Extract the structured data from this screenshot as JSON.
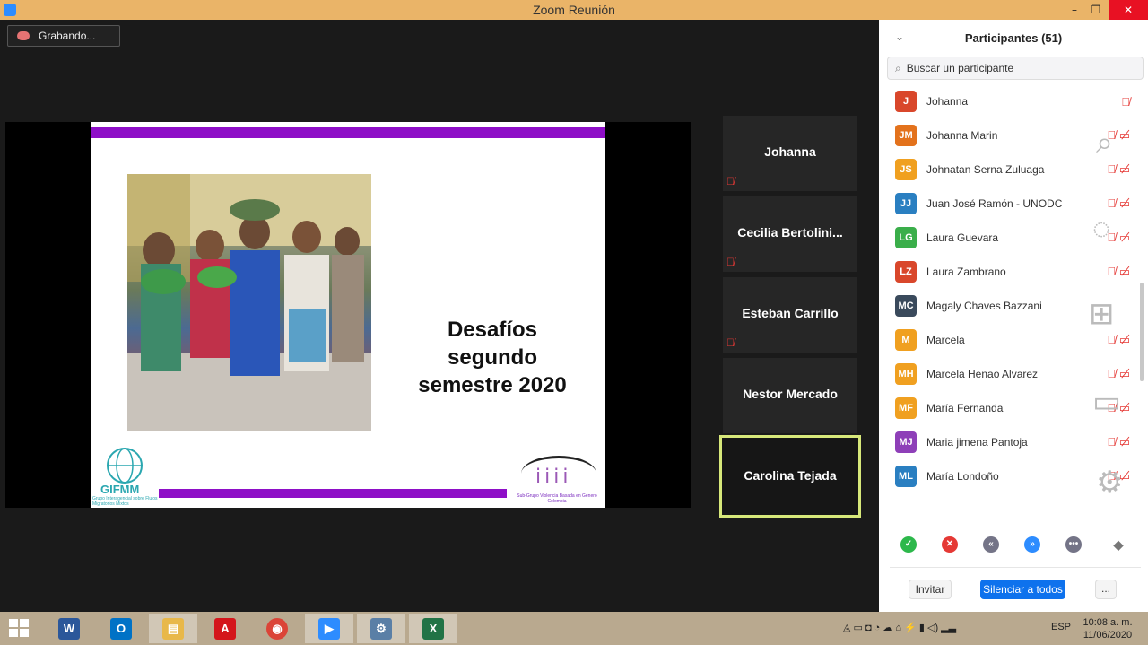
{
  "window": {
    "title": "Zoom Reunión"
  },
  "recording": {
    "label": "Grabando..."
  },
  "slide": {
    "title_lines": [
      "Desafíos",
      "segundo",
      "semestre 2020"
    ],
    "left_logo_text": "GIFMM",
    "left_logo_subtitle": "Grupo Interagencial sobre Flujos Migratorios Mixtos",
    "right_logo_caption": "Sub-Grupo Violencia Basada en Género Colombia"
  },
  "video_tiles": [
    {
      "name": "Johanna",
      "muted": true
    },
    {
      "name": "Cecilia  Bertolini...",
      "muted": true
    },
    {
      "name": "Esteban Carrillo",
      "muted": true
    },
    {
      "name": "Nestor Mercado",
      "muted": false
    },
    {
      "name": "Carolina Tejada",
      "muted": false,
      "active": true
    }
  ],
  "participants_panel": {
    "title": "Participantes (51)",
    "search_placeholder": "Buscar un participante",
    "participants": [
      {
        "initials": "J",
        "name": "Johanna",
        "color": "#d9472b"
      },
      {
        "initials": "JM",
        "name": "Johanna Marin",
        "color": "#e3721c"
      },
      {
        "initials": "JS",
        "name": "Johnatan Serna Zuluaga",
        "color": "#f0a020"
      },
      {
        "initials": "JJ",
        "name": "Juan José Ramón - UNODC",
        "color": "#2a7fc1"
      },
      {
        "initials": "LG",
        "name": "Laura Guevara",
        "color": "#3aae4a"
      },
      {
        "initials": "LZ",
        "name": "Laura Zambrano",
        "color": "#d9472b"
      },
      {
        "initials": "MC",
        "name": "Magaly Chaves Bazzani",
        "color": "#3a4a5c"
      },
      {
        "initials": "M",
        "name": "Marcela",
        "color": "#f0a020"
      },
      {
        "initials": "MH",
        "name": "Marcela Henao Alvarez",
        "color": "#f0a020"
      },
      {
        "initials": "MF",
        "name": "María Fernanda",
        "color": "#f0a020"
      },
      {
        "initials": "MJ",
        "name": "Maria jimena Pantoja",
        "color": "#8e3fb8"
      },
      {
        "initials": "ML",
        "name": "María Londoño",
        "color": "#2a7fc1"
      }
    ],
    "buttons": {
      "invite": "Invitar",
      "mute_all": "Silenciar a todos",
      "more": "..."
    }
  },
  "taskbar": {
    "apps": [
      {
        "name": "word",
        "glyph": "W",
        "color": "#2b579a"
      },
      {
        "name": "outlook",
        "glyph": "O",
        "color": "#0072c6"
      },
      {
        "name": "file-explorer",
        "glyph": "▤",
        "color": "#e8b84a"
      },
      {
        "name": "acrobat",
        "glyph": "A",
        "color": "#d4151b"
      },
      {
        "name": "chrome",
        "glyph": "◉",
        "color": "#db4437"
      },
      {
        "name": "zoom",
        "glyph": "▶",
        "color": "#2d8cff"
      },
      {
        "name": "control-panel",
        "glyph": "⚙",
        "color": "#5a7fa6"
      },
      {
        "name": "excel",
        "glyph": "X",
        "color": "#217346"
      }
    ],
    "language": "ESP",
    "time": "10:08 a. m.",
    "date": "11/06/2020"
  }
}
